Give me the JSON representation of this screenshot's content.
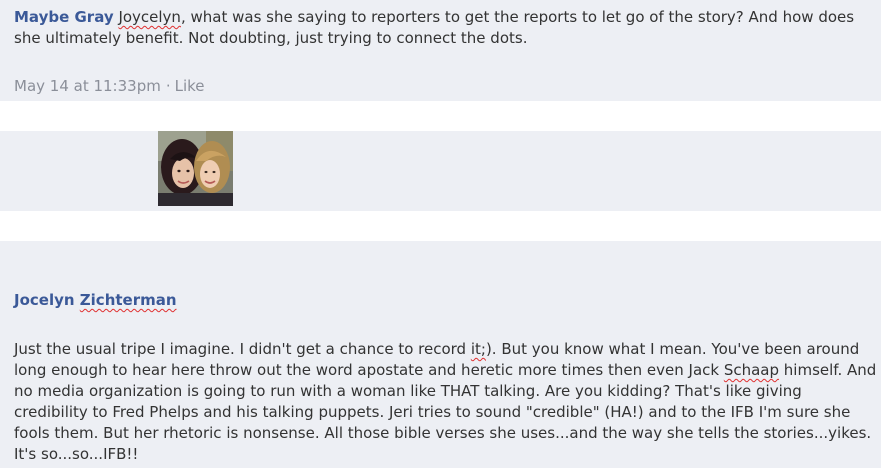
{
  "comment1": {
    "author": "Maybe Gray",
    "body_misspelled": "Joycelyn",
    "body_rest": ", what was she saying to reporters to get the reports to let go of the story? And how does she ultimately benefit. Not doubting, just trying to connect the dots.",
    "timestamp": "May 14 at 11:33pm",
    "separator": "·",
    "like_label": "Like"
  },
  "comment2": {
    "avatar_icon": "profile-photo-two-women",
    "author_first": "Jocelyn ",
    "author_last": "Zichterman",
    "body_part1": "Just the usual tripe I imagine. I didn't get a chance to record ",
    "body_squig1": "it;",
    "body_part2": "). But you know what I mean. You've been around long enough to hear here throw out the word apostate and heretic more times then even Jack ",
    "body_squig2": "Schaap",
    "body_part3": " himself. And no media organization is going to run with a woman like THAT talking. Are you kidding? That's like giving credibility to Fred Phelps and his talking puppets. Jeri tries to sound \"credible\" (HA!) and to the IFB I'm sure she fools them. But her rhetoric is nonsense. All those bible verses she uses...and the way she tells the stories...yikes. It's so...so...IFB!!"
  },
  "colors": {
    "panel_bg": "#edeff4",
    "author_blue": "#3b5998",
    "meta_gray": "#8b8f99",
    "spellcheck_red": "#e03030"
  }
}
